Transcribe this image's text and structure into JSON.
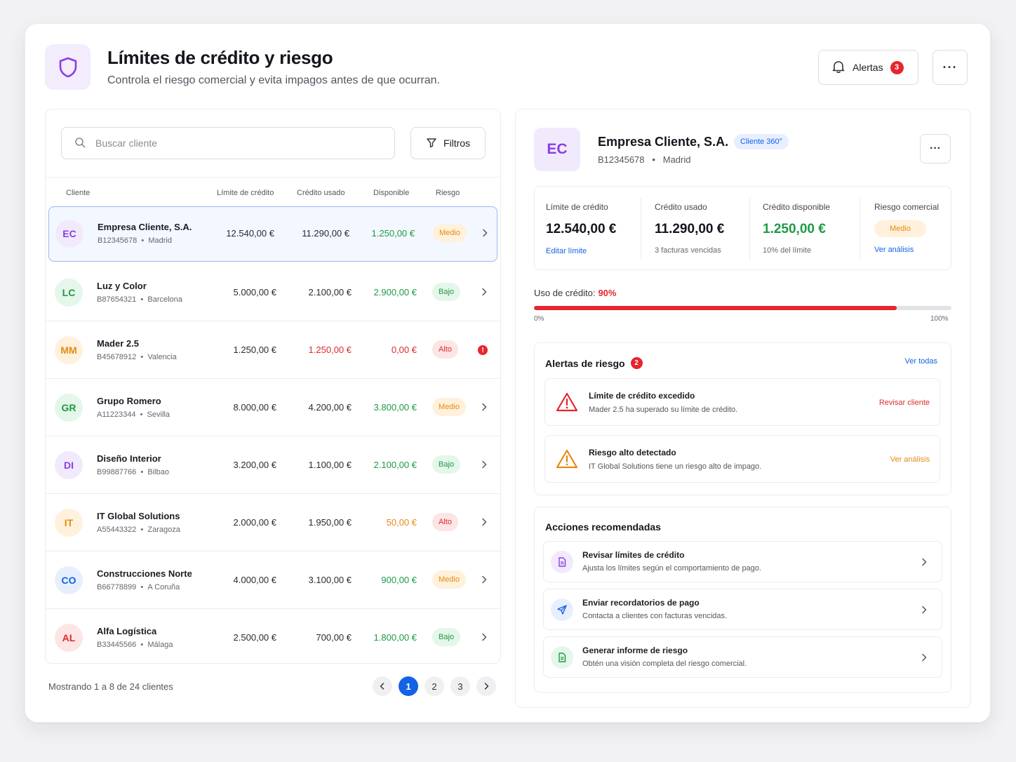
{
  "header": {
    "title": "Límites de crédito y riesgo",
    "subtitle": "Controla el riesgo comercial y evita impagos antes de que ocurran.",
    "alerts_label": "Alertas",
    "alerts_count": "3",
    "more_label": "···"
  },
  "list": {
    "search_placeholder": "Buscar cliente",
    "filters_label": "Filtros",
    "columns": {
      "client": "Cliente",
      "limit": "Límite de crédito",
      "used": "Crédito usado",
      "available": "Disponible",
      "risk": "Riesgo"
    },
    "rows": [
      {
        "initials": "EC",
        "name": "Empresa Cliente, S.A.",
        "cif": "B12345678",
        "city": "Madrid",
        "limit": "12.540,00 €",
        "used": "11.290,00 €",
        "available": "1.250,00 €",
        "risk": "Medio",
        "avatar_bg": "#f1eafc",
        "avatar_fg": "#8a3ee6",
        "avail_color": "#1e9a46",
        "used_color": "#2a2a33"
      },
      {
        "initials": "LC",
        "name": "Luz y Color",
        "cif": "B87654321",
        "city": "Barcelona",
        "limit": "5.000,00 €",
        "used": "2.100,00 €",
        "available": "2.900,00 €",
        "risk": "Bajo",
        "avatar_bg": "#e5f6ea",
        "avatar_fg": "#1e9a46",
        "avail_color": "#1e9a46",
        "used_color": "#2a2a33"
      },
      {
        "initials": "MM",
        "name": "Mader 2.5",
        "cif": "B45678912",
        "city": "Valencia",
        "limit": "1.250,00 €",
        "used": "1.250,00 €",
        "available": "0,00 €",
        "risk": "Alto",
        "avatar_bg": "#fff1dc",
        "avatar_fg": "#e58a13",
        "avail_color": "#dd2b2b",
        "used_color": "#dd2b2b"
      },
      {
        "initials": "GR",
        "name": "Grupo Romero",
        "cif": "A11223344",
        "city": "Sevilla",
        "limit": "8.000,00 €",
        "used": "4.200,00 €",
        "available": "3.800,00 €",
        "risk": "Medio",
        "avatar_bg": "#e5f6ea",
        "avatar_fg": "#1e9a46",
        "avail_color": "#1e9a46",
        "used_color": "#2a2a33"
      },
      {
        "initials": "DI",
        "name": "Diseño Interior",
        "cif": "B99887766",
        "city": "Bilbao",
        "limit": "3.200,00 €",
        "used": "1.100,00 €",
        "available": "2.100,00 €",
        "risk": "Bajo",
        "avatar_bg": "#f1eafc",
        "avatar_fg": "#8a3ee6",
        "avail_color": "#1e9a46",
        "used_color": "#2a2a33"
      },
      {
        "initials": "IT",
        "name": "IT Global Solutions",
        "cif": "A55443322",
        "city": "Zaragoza",
        "limit": "2.000,00 €",
        "used": "1.950,00 €",
        "available": "50,00 €",
        "risk": "Alto",
        "avatar_bg": "#fff1dc",
        "avatar_fg": "#e58a13",
        "avail_color": "#e58a13",
        "used_color": "#2a2a33"
      },
      {
        "initials": "CO",
        "name": "Construcciones Norte",
        "cif": "B66778899",
        "city": "A Coruña",
        "limit": "4.000,00 €",
        "used": "3.100,00 €",
        "available": "900,00 €",
        "risk": "Medio",
        "avatar_bg": "#e7efff",
        "avatar_fg": "#1462e6",
        "avail_color": "#1e9a46",
        "used_color": "#2a2a33"
      },
      {
        "initials": "AL",
        "name": "Alfa Logística",
        "cif": "B33445566",
        "city": "Málaga",
        "limit": "2.500,00 €",
        "used": "700,00 €",
        "available": "1.800,00 €",
        "risk": "Bajo",
        "avatar_bg": "#fde5e5",
        "avatar_fg": "#dd2b2b",
        "avail_color": "#1e9a46",
        "used_color": "#2a2a33"
      }
    ],
    "footer": "Mostrando 1 a 8 de 24 clientes",
    "pages": [
      "1",
      "2",
      "3"
    ],
    "warning_glyph": "!"
  },
  "detail": {
    "initials": "EC",
    "name": "Empresa Cliente, S.A.",
    "tag": "Cliente 360°",
    "cif": "B12345678",
    "city": "Madrid",
    "stats": {
      "limit_label": "Límite de crédito",
      "limit_value": "12.540,00 €",
      "limit_link": "Editar límite",
      "used_label": "Crédito usado",
      "used_value": "11.290,00 €",
      "used_sub": "3 facturas vencidas",
      "available_label": "Crédito disponible",
      "available_value": "1.250,00 €",
      "available_sub": "10% del límite",
      "risk_label": "Riesgo comercial",
      "risk_value": "Medio",
      "risk_link": "Ver análisis"
    },
    "usage": {
      "label": "Uso de crédito:",
      "percent_label": "90%",
      "percent": 90,
      "min": "0%",
      "max": "100%"
    },
    "alerts": {
      "title": "Alertas de riesgo",
      "count": "2",
      "see_all": "Ver todas",
      "items": [
        {
          "title": "Límite de crédito excedido",
          "desc": "Mader 2.5 ha superado su límite de crédito.",
          "action": "Revisar cliente"
        },
        {
          "title": "Riesgo alto detectado",
          "desc": "IT Global Solutions tiene un riesgo alto de impago.",
          "action": "Ver análisis"
        }
      ]
    },
    "actions": {
      "title": "Acciones recomendadas",
      "items": [
        {
          "title": "Revisar límites de crédito",
          "desc": "Ajusta los límites según el comportamiento de pago."
        },
        {
          "title": "Enviar recordatorios de pago",
          "desc": "Contacta a clientes con facturas vencidas."
        },
        {
          "title": "Generar informe de riesgo",
          "desc": "Obtén una visión completa del riesgo comercial."
        }
      ]
    }
  },
  "colors": {
    "accent": "#1462e6",
    "danger": "#e5262e",
    "success": "#1e9a46",
    "warning": "#e58a13"
  }
}
